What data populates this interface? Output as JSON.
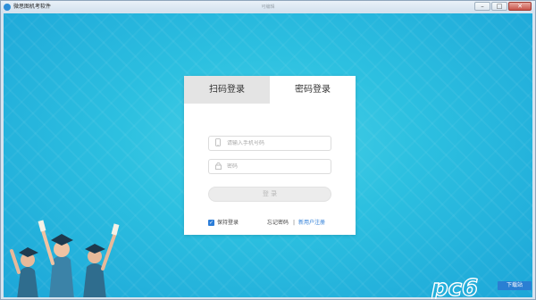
{
  "window": {
    "title": "微思图机考软件",
    "center_title": "可编辑",
    "minimize": "–",
    "maximize": "□",
    "close": "✕"
  },
  "login": {
    "tab_qr": "扫码登录",
    "tab_password": "密码登录",
    "phone_placeholder": "请输入手机号码",
    "password_placeholder": "密码",
    "login_button": "登 录",
    "keep_login": "保持登录",
    "forgot_password": "忘记密码",
    "separator": "|",
    "register": "新用户注册"
  },
  "watermark": {
    "text": "pc6",
    "badge": "下载站"
  },
  "colors": {
    "accent": "#2c7dd8",
    "background": "#2cc0e0"
  }
}
